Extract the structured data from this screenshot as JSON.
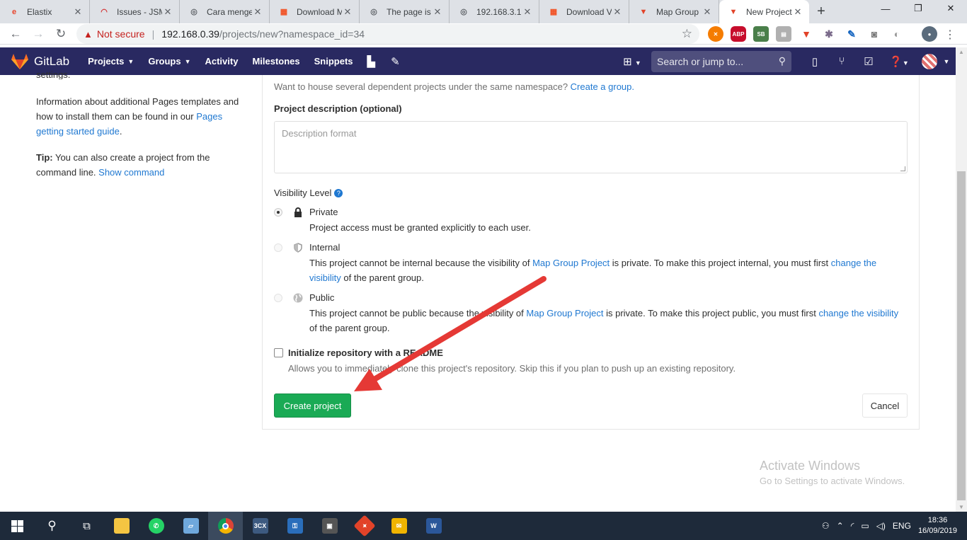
{
  "browser": {
    "tabs": [
      {
        "title": "Elastix",
        "fav_color": "#e8452c",
        "fav_glyph": "e"
      },
      {
        "title": "Issues - JSM",
        "fav_color": "#d32f2f",
        "fav_glyph": "◠"
      },
      {
        "title": "Cara menge",
        "fav_color": "#5f6368",
        "fav_glyph": "◎"
      },
      {
        "title": "Download M",
        "fav_color": "#f25022",
        "fav_glyph": "▦"
      },
      {
        "title": "The page is",
        "fav_color": "#5f6368",
        "fav_glyph": "◎"
      },
      {
        "title": "192.168.3.1",
        "fav_color": "#5f6368",
        "fav_glyph": "◎"
      },
      {
        "title": "Download V",
        "fav_color": "#f25022",
        "fav_glyph": "▦"
      },
      {
        "title": "Map Group",
        "fav_color": "#e24329",
        "fav_glyph": "▼"
      },
      {
        "title": "New Project",
        "fav_color": "#e24329",
        "fav_glyph": "▼"
      }
    ],
    "new_tab": "+",
    "not_secure": "Not secure",
    "url_host": "192.168.0.39",
    "url_path": "/projects/new?namespace_id=34"
  },
  "gitlab_nav": {
    "brand": "GitLab",
    "links": [
      "Projects",
      "Groups",
      "Activity",
      "Milestones",
      "Snippets"
    ],
    "search_placeholder": "Search or jump to..."
  },
  "sidebar": {
    "cut_text": "settings.",
    "info_text": "Information about additional Pages templates and how to install them can be found in our ",
    "info_link": "Pages getting started guide",
    "info_end": ".",
    "tip_label": "Tip:",
    "tip_text": " You can also create a project from the command line. ",
    "tip_link": "Show command"
  },
  "form": {
    "group_hint": "Want to house several dependent projects under the same namespace? ",
    "group_hint_link": "Create a group.",
    "description_label": "Project description (optional)",
    "description_placeholder": "Description format",
    "visibility_label": "Visibility Level",
    "visibility": [
      {
        "title": "Private",
        "checked": true,
        "disabled": false,
        "desc_a": "Project access must be granted explicitly to each user.",
        "desc_link1": "",
        "desc_b": "",
        "desc_link2": "",
        "desc_c": ""
      },
      {
        "title": "Internal",
        "checked": false,
        "disabled": true,
        "desc_a": "This project cannot be internal because the visibility of ",
        "desc_link1": "Map Group Project",
        "desc_b": " is private. To make this project internal, you must first ",
        "desc_link2": "change the visibility",
        "desc_c": " of the parent group."
      },
      {
        "title": "Public",
        "checked": false,
        "disabled": true,
        "desc_a": "This project cannot be public because the visibility of ",
        "desc_link1": "Map Group Project",
        "desc_b": " is private. To make this project public, you must first ",
        "desc_link2": "change the visibility",
        "desc_c": " of the parent group."
      }
    ],
    "readme_label": "Initialize repository with a README",
    "readme_help": "Allows you to immediately clone this project's repository. Skip this if you plan to push up an existing repository.",
    "create_button": "Create project",
    "cancel_button": "Cancel"
  },
  "watermark": {
    "line1": "Activate Windows",
    "line2": "Go to Settings to activate Windows."
  },
  "taskbar": {
    "language": "ENG",
    "time": "18:36",
    "date": "16/09/2019"
  }
}
